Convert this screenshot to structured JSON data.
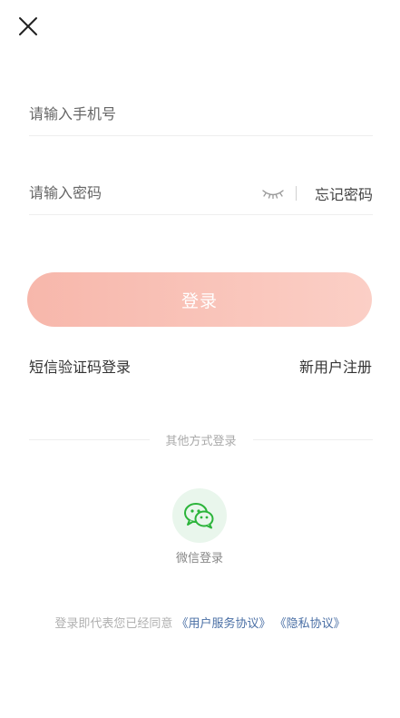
{
  "phone_field": {
    "placeholder": "请输入手机号"
  },
  "password_field": {
    "placeholder": "请输入密码"
  },
  "forgot_password": "忘记密码",
  "login_button": "登录",
  "sms_login": "短信验证码登录",
  "register": "新用户注册",
  "other_methods": "其他方式登录",
  "wechat_login": "微信登录",
  "agreement": {
    "prefix": "登录即代表您已经同意",
    "user_agreement": "《用户服务协议》",
    "privacy_policy": "《隐私协议》"
  },
  "colors": {
    "login_button_start": "#f7b7ab",
    "login_button_end": "#fbcfc6",
    "wechat_green": "#2bb43a",
    "wechat_bg": "#e9f6ec",
    "link_blue": "#4a6fa5"
  },
  "icons": [
    "close-icon",
    "eye-closed-icon",
    "wechat-icon"
  ]
}
